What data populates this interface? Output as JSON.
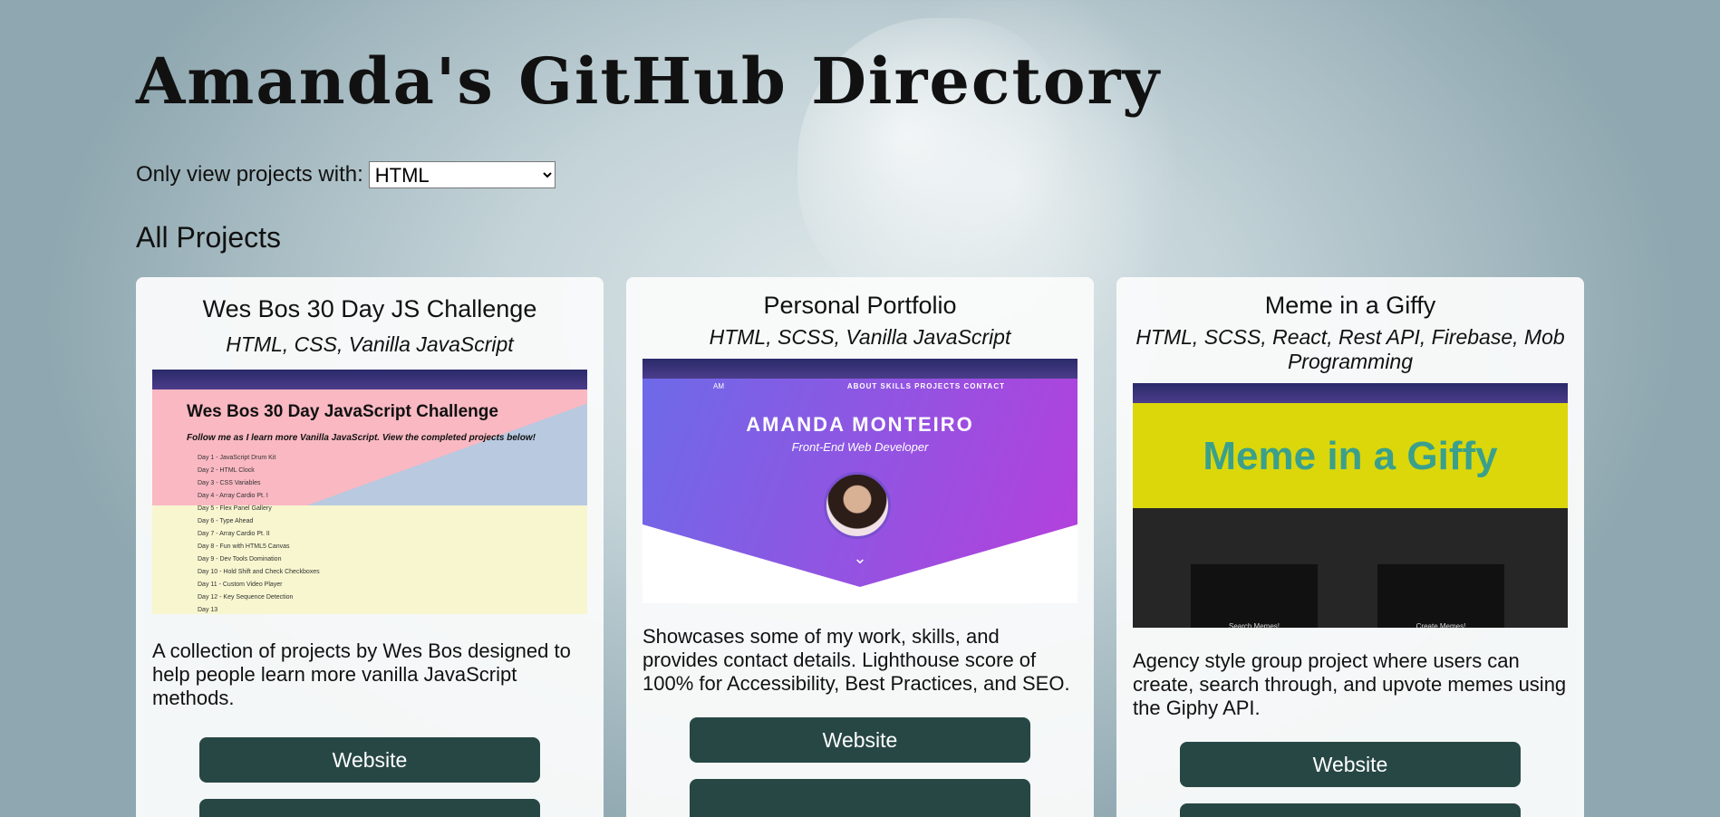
{
  "header": {
    "title": "Amanda's GitHub Directory"
  },
  "filter": {
    "label": "Only view projects with:",
    "selected": "HTML"
  },
  "section": {
    "title": "All Projects"
  },
  "colors": {
    "button_bg": "#274745",
    "card_bg": "#fafbfb"
  },
  "projects": [
    {
      "title": "Wes Bos 30 Day JS Challenge",
      "tech": "HTML, CSS, Vanilla JavaScript",
      "description": "A collection of projects by Wes Bos designed to help people learn more vanilla JavaScript methods.",
      "website_label": "Website",
      "thumb": {
        "heading": "Wes Bos 30 Day JavaScript Challenge",
        "subheading": "Follow me as I learn more Vanilla JavaScript. View the completed projects below!",
        "items": [
          "Day 1 - JavaScript Drum Kit",
          "Day 2 - HTML Clock",
          "Day 3 - CSS Variables",
          "Day 4 - Array Cardio Pt. I",
          "Day 5 - Flex Panel Gallery",
          "Day 6 - Type Ahead",
          "Day 7 - Array Cardio Pt. II",
          "Day 8 - Fun with HTML5 Canvas",
          "Day 9 - Dev Tools Domination",
          "Day 10 - Hold Shift and Check Checkboxes",
          "Day 11 - Custom Video Player",
          "Day 12 - Key Sequence Detection",
          "Day 13"
        ]
      }
    },
    {
      "title": "Personal Portfolio",
      "tech": "HTML, SCSS, Vanilla JavaScript",
      "description": "Showcases some of my work, skills, and provides contact details. Lighthouse score of 100% for Accessibility, Best Practices, and SEO.",
      "website_label": "Website",
      "thumb": {
        "nav": "ABOUT  SKILLS  PROJECTS  CONTACT",
        "initials": "AM",
        "name": "AMANDA MONTEIRO",
        "role": "Front-End Web Developer"
      }
    },
    {
      "title": "Meme in a Giffy",
      "tech": "HTML, SCSS, React, Rest API, Firebase, Mob Programming",
      "description": "Agency style group project where users can create, search through, and upvote memes using the Giphy API.",
      "website_label": "Website",
      "thumb": {
        "logo": "Meme in a Giffy",
        "search": "Search Memes!",
        "create": "Create Memes!"
      }
    }
  ]
}
